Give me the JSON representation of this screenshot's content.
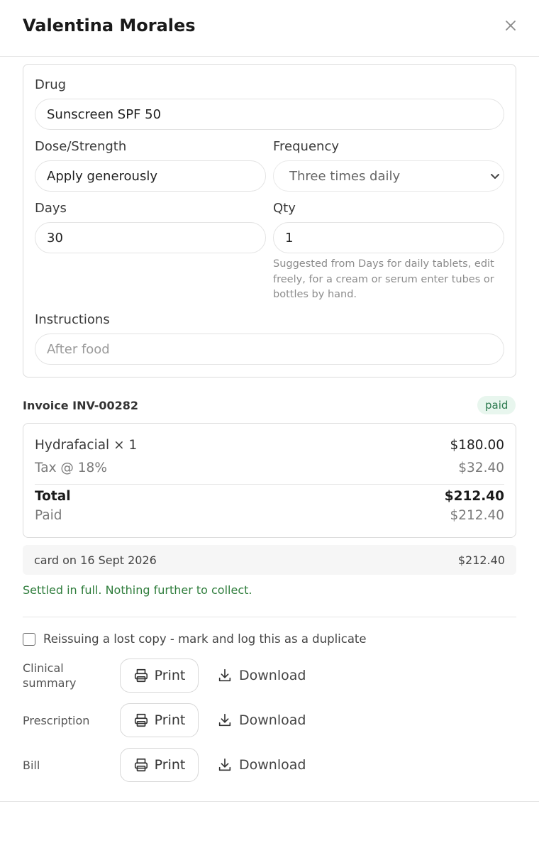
{
  "header": {
    "title": "Valentina Morales",
    "close_icon": "close-icon"
  },
  "prescription": {
    "drug": {
      "label": "Drug",
      "value": "Sunscreen SPF 50"
    },
    "dose": {
      "label": "Dose/Strength",
      "value": "Apply generously"
    },
    "frequency": {
      "label": "Frequency",
      "value": "Three times daily"
    },
    "days": {
      "label": "Days",
      "value": "30"
    },
    "qty": {
      "label": "Qty",
      "value": "1",
      "hint_lines": [
        "Suggested from Days for daily tablets, edit",
        "freely, for a cream or serum enter tubes or",
        "bottles by hand."
      ]
    },
    "instructions": {
      "label": "Instructions",
      "placeholder": "After food"
    }
  },
  "invoice": {
    "title": "Invoice INV-00282",
    "status": "paid",
    "status_color": "#2c7a4f",
    "line_item": {
      "label": "Hydrafacial × 1",
      "amount": "$180.00"
    },
    "tax": {
      "label": "Tax @ 18%",
      "amount": "$32.40"
    },
    "total": {
      "label": "Total",
      "amount": "$212.40"
    },
    "paid": {
      "label": "Paid",
      "amount": "$212.40"
    },
    "payment": {
      "method": "card on 16 Sept 2026",
      "amount": "$212.40"
    },
    "settled_message": "Settled in full. Nothing further to collect."
  },
  "duplicate": {
    "label": "Reissuing a lost copy - mark and log this as a duplicate",
    "checked": false
  },
  "documents": {
    "print_label": "Print",
    "download_label": "Download",
    "clinical_lines": [
      "Clinical",
      "summary"
    ],
    "prescription": "Prescription",
    "bill": "Bill"
  }
}
